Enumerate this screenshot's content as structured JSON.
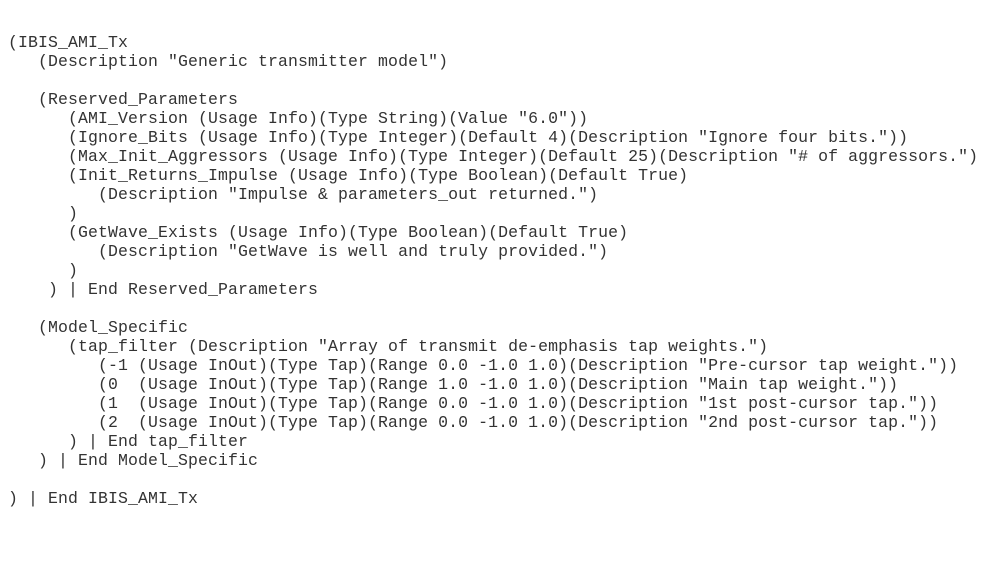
{
  "document": {
    "lines": [
      {
        "indent": 0,
        "text": "(IBIS_AMI_Tx"
      },
      {
        "indent": 3,
        "text": "(Description \"Generic transmitter model\")"
      },
      {
        "indent": 0,
        "text": ""
      },
      {
        "indent": 3,
        "text": "(Reserved_Parameters"
      },
      {
        "indent": 6,
        "text": "(AMI_Version (Usage Info)(Type String)(Value \"6.0\"))"
      },
      {
        "indent": 6,
        "text": "(Ignore_Bits (Usage Info)(Type Integer)(Default 4)(Description \"Ignore four bits.\"))"
      },
      {
        "indent": 6,
        "text": "(Max_Init_Aggressors (Usage Info)(Type Integer)(Default 25)(Description \"# of aggressors.\")"
      },
      {
        "indent": 6,
        "text": "(Init_Returns_Impulse (Usage Info)(Type Boolean)(Default True)"
      },
      {
        "indent": 9,
        "text": "(Description \"Impulse & parameters_out returned.\")"
      },
      {
        "indent": 6,
        "text": ")"
      },
      {
        "indent": 6,
        "text": "(GetWave_Exists (Usage Info)(Type Boolean)(Default True)"
      },
      {
        "indent": 9,
        "text": "(Description \"GetWave is well and truly provided.\")"
      },
      {
        "indent": 6,
        "text": ")"
      },
      {
        "indent": 4,
        "text": ") | End Reserved_Parameters"
      },
      {
        "indent": 0,
        "text": ""
      },
      {
        "indent": 3,
        "text": "(Model_Specific"
      },
      {
        "indent": 6,
        "text": "(tap_filter (Description \"Array of transmit de-emphasis tap weights.\")"
      },
      {
        "indent": 9,
        "text": "(-1 (Usage InOut)(Type Tap)(Range 0.0 -1.0 1.0)(Description \"Pre-cursor tap weight.\"))"
      },
      {
        "indent": 9,
        "text": "(0  (Usage InOut)(Type Tap)(Range 1.0 -1.0 1.0)(Description \"Main tap weight.\"))"
      },
      {
        "indent": 9,
        "text": "(1  (Usage InOut)(Type Tap)(Range 0.0 -1.0 1.0)(Description \"1st post-cursor tap.\"))"
      },
      {
        "indent": 9,
        "text": "(2  (Usage InOut)(Type Tap)(Range 0.0 -1.0 1.0)(Description \"2nd post-cursor tap.\"))"
      },
      {
        "indent": 6,
        "text": ") | End tap_filter"
      },
      {
        "indent": 3,
        "text": ") | End Model_Specific"
      },
      {
        "indent": 0,
        "text": ""
      },
      {
        "indent": 0,
        "text": ") | End IBIS_AMI_Tx"
      }
    ]
  }
}
